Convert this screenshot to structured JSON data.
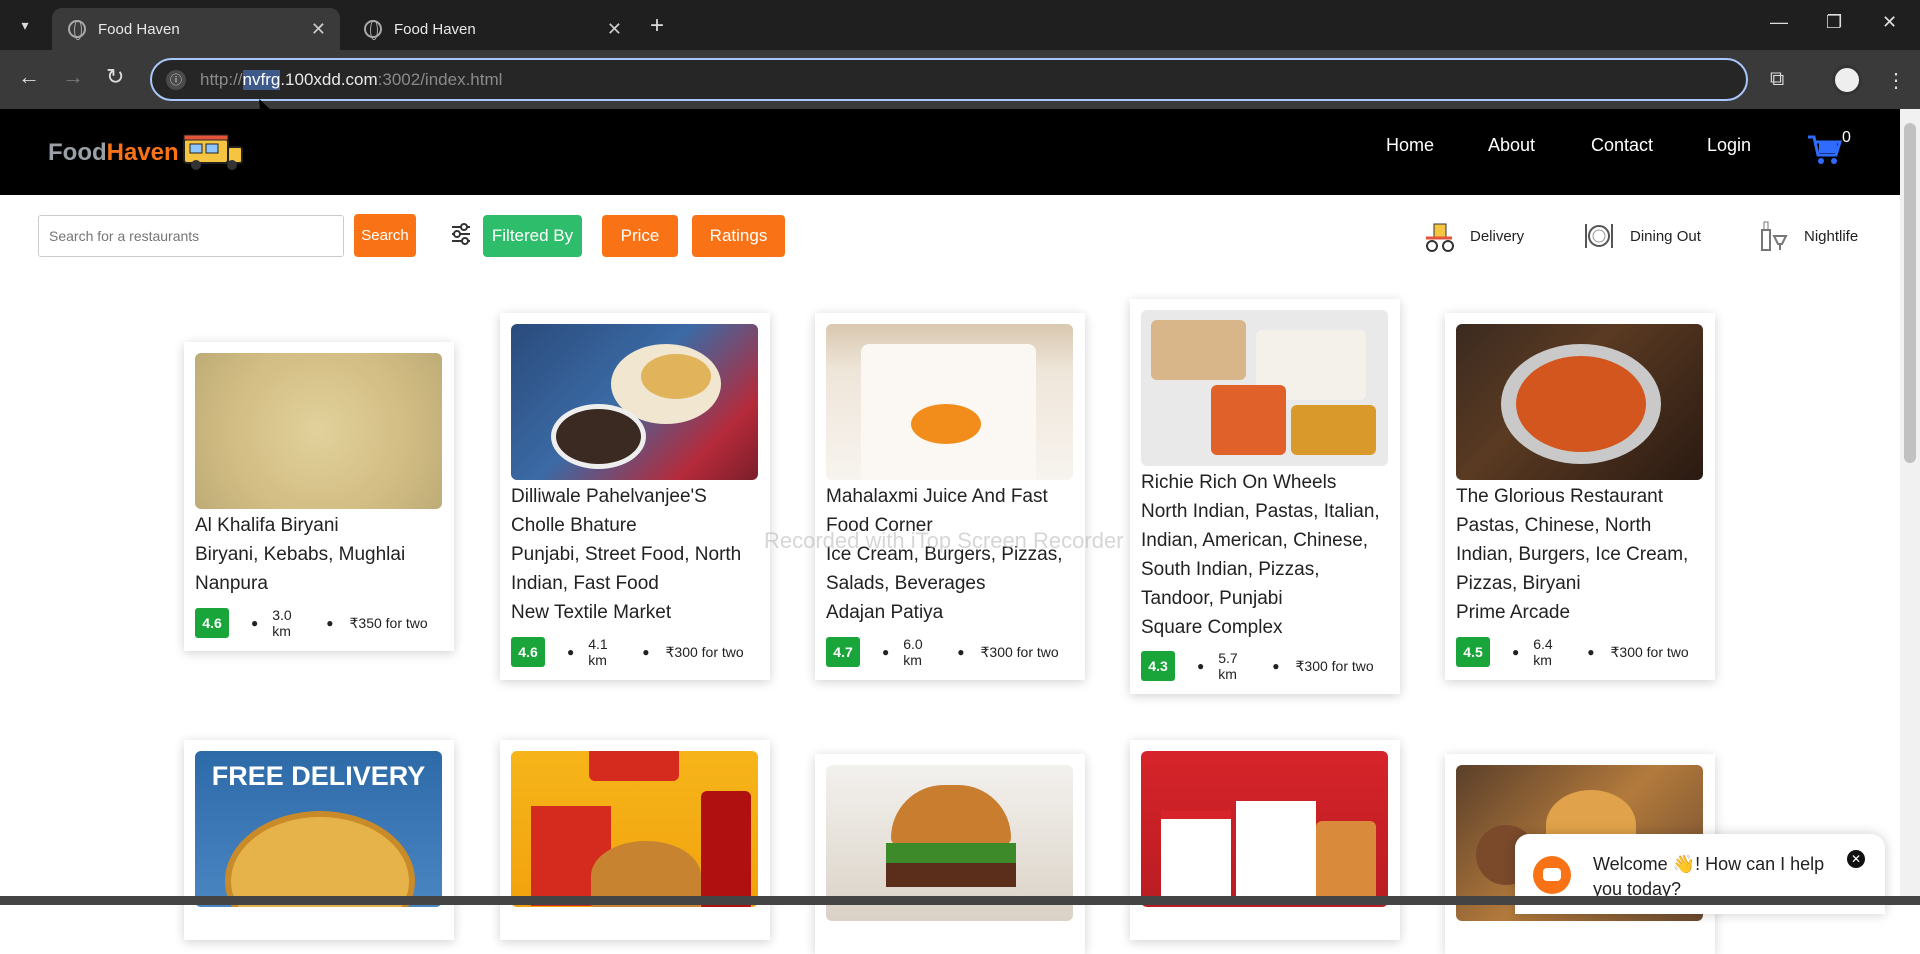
{
  "browser": {
    "tabs": [
      {
        "title": "Food Haven",
        "active": true
      },
      {
        "title": "Food Haven",
        "active": false
      }
    ],
    "url_prefix": "http://",
    "url_selected": "nvfrg",
    "url_host": ".100xdd.com",
    "url_rest": ":3002/index.html"
  },
  "header": {
    "logo_food": "Food",
    "logo_haven": "Haven",
    "nav": [
      "Home",
      "About",
      "Contact",
      "Login"
    ],
    "cart_count": "0"
  },
  "filters": {
    "search_placeholder": "Search for a restaurants",
    "search_button": "Search",
    "filtered_by": "Filtered By",
    "price": "Price",
    "ratings": "Ratings",
    "categories": [
      "Delivery",
      "Dining Out",
      "Nightlife"
    ]
  },
  "restaurants": [
    {
      "name": "Al Khalifa Biryani",
      "cuisine": "Biryani, Kebabs, Mughlai",
      "location": "Nanpura",
      "rating": "4.6",
      "distance": "3.0 km",
      "price": "₹350 for two"
    },
    {
      "name": "Dilliwale Pahelvanjee'S Cholle Bhature",
      "cuisine": "Punjabi, Street Food, North Indian, Fast Food",
      "location": "New Textile Market",
      "rating": "4.6",
      "distance": "4.1 km",
      "price": "₹300 for two"
    },
    {
      "name": "Mahalaxmi Juice And Fast Food Corner",
      "cuisine": "Ice Cream, Burgers, Pizzas, Salads, Beverages",
      "location": "Adajan Patiya",
      "rating": "4.7",
      "distance": "6.0 km",
      "price": "₹300 for two"
    },
    {
      "name": "Richie Rich On Wheels",
      "cuisine": "North Indian, Pastas, Italian, Indian, American, Chinese, South Indian, Pizzas, Tandoor, Punjabi",
      "location": "Square Complex",
      "rating": "4.3",
      "distance": "5.7 km",
      "price": "₹300 for two"
    },
    {
      "name": "The Glorious Restaurant",
      "cuisine": "Pastas, Chinese, North Indian, Burgers, Ice Cream, Pizzas, Biryani",
      "location": "Prime Arcade",
      "rating": "4.5",
      "distance": "6.4 km",
      "price": "₹300 for two"
    }
  ],
  "second_row": {
    "free_delivery": "FREE DELIVERY"
  },
  "watermark": "Recorded with iTop Screen Recorder",
  "chat": {
    "message": "Welcome 👋! How can I help you today?"
  }
}
